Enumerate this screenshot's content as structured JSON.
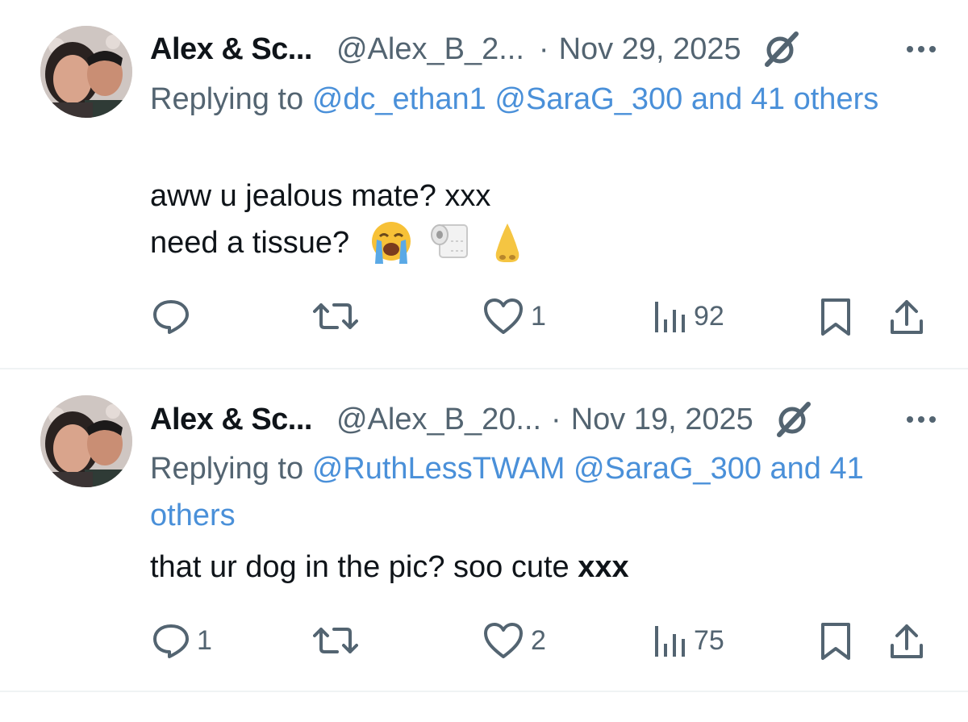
{
  "tweets": [
    {
      "name": "Alex & Sc...",
      "handle": "@Alex_B_2...",
      "separator": "·",
      "date": "Nov 29, 2025",
      "replying_prefix": "Replying to",
      "reply_mentions": [
        "@dc_ethan1",
        "@SaraG_300"
      ],
      "reply_suffix": "and 41 others",
      "text_lines": [
        "aww u jealous mate? xxx",
        "need a tissue?"
      ],
      "emojis": [
        "loudly-crying-face",
        "toilet-paper",
        "nose"
      ],
      "stats": {
        "replies": "",
        "reposts": "",
        "likes": "1",
        "views": "92"
      }
    },
    {
      "name": "Alex & Sc...",
      "handle": "@Alex_B_20...",
      "separator": "·",
      "date": "Nov 19, 2025",
      "replying_prefix": "Replying to",
      "reply_mentions": [
        "@RuthLessTWAM",
        "@SaraG_300"
      ],
      "reply_suffix": "and 41 others",
      "text_main": "that ur dog in the pic? soo cute",
      "text_bold": "xxx",
      "stats": {
        "replies": "1",
        "reposts": "",
        "likes": "2",
        "views": "75"
      }
    }
  ],
  "colors": {
    "link": "#4a90d9",
    "muted": "#536471",
    "text": "#0f1419",
    "divider": "#eff3f4"
  },
  "icons": [
    "reply-icon",
    "repost-icon",
    "like-icon",
    "views-icon",
    "bookmark-icon",
    "share-icon",
    "grok-icon",
    "more-icon"
  ]
}
